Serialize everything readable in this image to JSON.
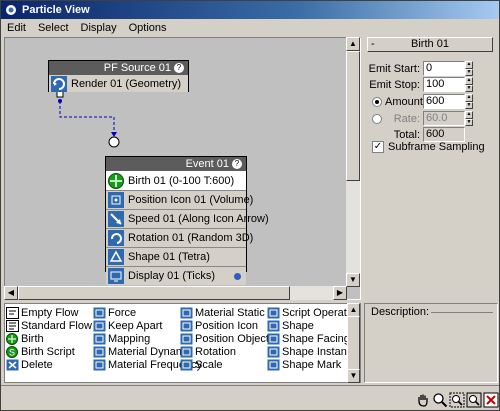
{
  "window": {
    "title": "Particle View"
  },
  "menu": [
    "Edit",
    "Select",
    "Display",
    "Options"
  ],
  "graph": {
    "source_node": {
      "title": "PF Source 01",
      "operators": [
        {
          "label": "Render 01 (Geometry)",
          "icon": "render-icon"
        }
      ]
    },
    "event_node": {
      "title": "Event 01",
      "operators": [
        {
          "label": "Birth 01 (0-100 T:600)",
          "icon": "birth-icon",
          "selected": true
        },
        {
          "label": "Position Icon 01 (Volume)",
          "icon": "position-icon-icon"
        },
        {
          "label": "Speed 01 (Along Icon Arrow)",
          "icon": "speed-icon"
        },
        {
          "label": "Rotation 01 (Random 3D)",
          "icon": "rotation-icon"
        },
        {
          "label": "Shape 01 (Tetra)",
          "icon": "shape-icon"
        },
        {
          "label": "Display 01 (Ticks)",
          "icon": "display-icon"
        }
      ]
    }
  },
  "params": {
    "rollout_title": "Birth 01",
    "emit_start_label": "Emit Start:",
    "emit_start": "0",
    "emit_stop_label": "Emit Stop:",
    "emit_stop": "100",
    "amount_label": "Amount:",
    "amount": "600",
    "rate_label": "Rate:",
    "rate": "60.0",
    "total_label": "Total:",
    "total": "600",
    "subframe_label": "Subframe Sampling",
    "subframe_checked": true
  },
  "depot": {
    "items": [
      {
        "label": "Empty Flow",
        "icon": "empty-flow-icon"
      },
      {
        "label": "Force",
        "icon": "force-icon"
      },
      {
        "label": "Material Static",
        "icon": "material-static-icon"
      },
      {
        "label": "Script Operator",
        "icon": "script-operator-icon"
      },
      {
        "label": "Standard Flow",
        "icon": "standard-flow-icon"
      },
      {
        "label": "Keep Apart",
        "icon": "keep-apart-icon"
      },
      {
        "label": "Position Icon",
        "icon": "position-icon-icon"
      },
      {
        "label": "Shape",
        "icon": "shape-icon"
      },
      {
        "label": "Birth",
        "icon": "birth-icon"
      },
      {
        "label": "Mapping",
        "icon": "mapping-icon"
      },
      {
        "label": "Position Object",
        "icon": "position-object-icon"
      },
      {
        "label": "Shape Facing",
        "icon": "shape-facing-icon"
      },
      {
        "label": "Birth Script",
        "icon": "birth-script-icon"
      },
      {
        "label": "Material Dynamic",
        "icon": "material-dynamic-icon"
      },
      {
        "label": "Rotation",
        "icon": "rotation-icon"
      },
      {
        "label": "Shape Instance",
        "icon": "shape-instance-icon"
      },
      {
        "label": "Delete",
        "icon": "delete-icon"
      },
      {
        "label": "Material Frequency",
        "icon": "material-frequency-icon"
      },
      {
        "label": "Scale",
        "icon": "scale-icon"
      },
      {
        "label": "Shape Mark",
        "icon": "shape-mark-icon"
      }
    ]
  },
  "description": {
    "title": "Description:"
  },
  "toolbar": [
    "pan-hand-icon",
    "zoom-icon",
    "zoom-region-icon",
    "zoom-extents-icon",
    "delete-x-icon"
  ]
}
